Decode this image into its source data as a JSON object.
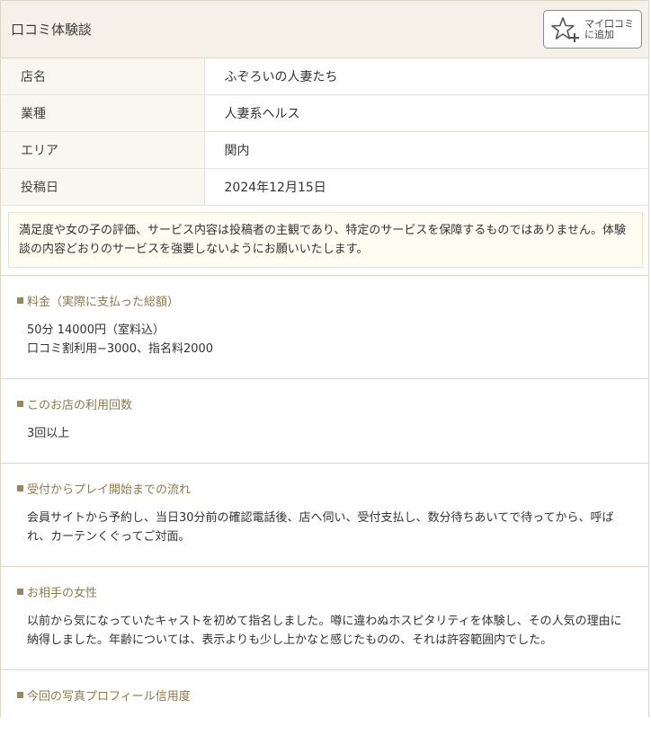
{
  "header": {
    "title": "口コミ体験談",
    "mylist_button": "マイ口コミ\nに追加"
  },
  "info": [
    {
      "key": "店名",
      "value": "ふぞろいの人妻たち"
    },
    {
      "key": "業種",
      "value": "人妻系ヘルス"
    },
    {
      "key": "エリア",
      "value": "関内"
    },
    {
      "key": "投稿日",
      "value": "2024年12月15日"
    }
  ],
  "notice": "満足度や女の子の評価、サービス内容は投稿者の主観であり、特定のサービスを保障するものではありません。体験談の内容どおりのサービスを強要しないようにお願いいたします。",
  "sections": [
    {
      "title": "料金（実際に支払った総額）",
      "body": "50分 14000円（室料込）\n口コミ割利用−3000、指名料2000"
    },
    {
      "title": "このお店の利用回数",
      "body": "3回以上"
    },
    {
      "title": "受付からプレイ開始までの流れ",
      "body": "会員サイトから予約し、当日30分前の確認電話後、店へ伺い、受付支払し、数分待ちあいてで待ってから、呼ばれ、カーテンくぐってご対面。"
    },
    {
      "title": "お相手の女性",
      "body": "以前から気になっていたキャストを初めて指名しました。噂に違わぬホスピタリティを体験し、その人気の理由に納得しました。年齢については、表示よりも少し上かなと感じたものの、それは許容範囲内でした。"
    },
    {
      "title": "今回の写真プロフィール信用度",
      "body": ""
    }
  ]
}
